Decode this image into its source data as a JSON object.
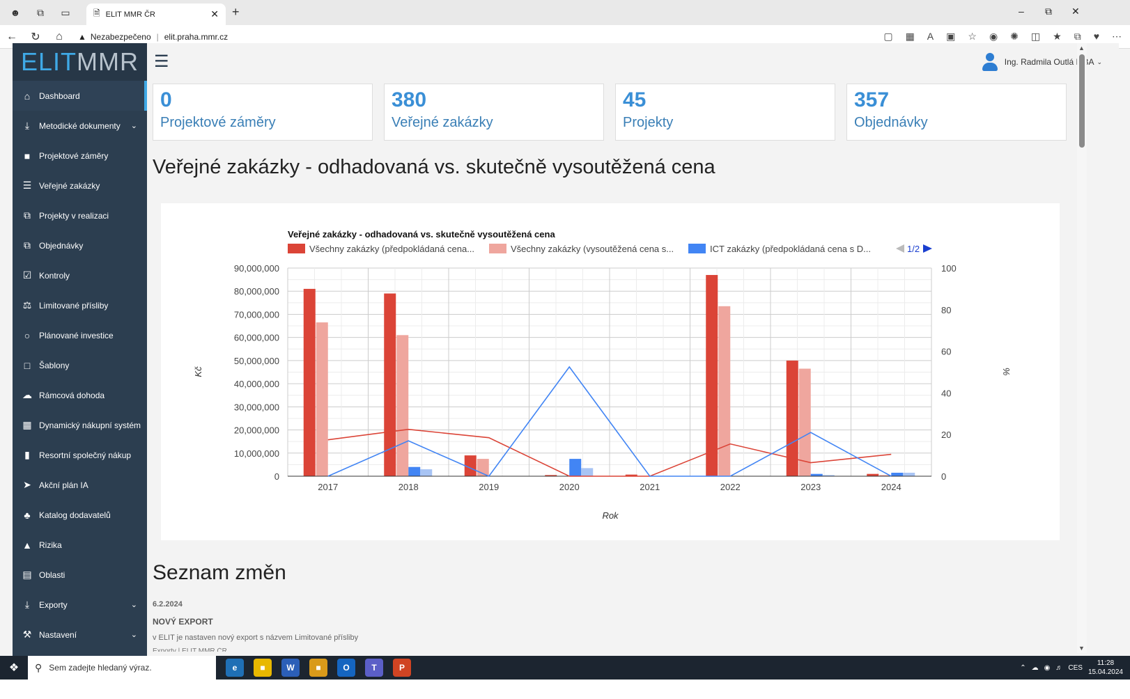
{
  "browser": {
    "tab_title": "ELIT MMR ČR",
    "address_warning": "Nezabezpečeno",
    "url": "elit.praha.mmr.cz"
  },
  "app": {
    "logo_part1": "ELIT",
    "logo_part2": "MMR",
    "user_name": "Ing. Radmila Outlá MBA"
  },
  "sidebar": {
    "items": [
      {
        "label": "Dashboard",
        "icon": "home-icon"
      },
      {
        "label": "Metodické dokumenty",
        "icon": "download-icon",
        "has_children": true
      },
      {
        "label": "Projektové záměry",
        "icon": "folder-icon"
      },
      {
        "label": "Veřejné zakázky",
        "icon": "list-icon"
      },
      {
        "label": "Projekty v realizaci",
        "icon": "copy-icon"
      },
      {
        "label": "Objednávky",
        "icon": "copy-icon"
      },
      {
        "label": "Kontroly",
        "icon": "check-square-icon"
      },
      {
        "label": "Limitované přísliby",
        "icon": "balance-icon"
      },
      {
        "label": "Plánované investice",
        "icon": "tag-icon"
      },
      {
        "label": "Šablony",
        "icon": "file-icon"
      },
      {
        "label": "Rámcová dohoda",
        "icon": "cloud-icon"
      },
      {
        "label": "Dynamický nákupní systém",
        "icon": "grid-icon"
      },
      {
        "label": "Resortní společný nákup",
        "icon": "building-icon"
      },
      {
        "label": "Akční plán IA",
        "icon": "paper-plane-icon"
      },
      {
        "label": "Katalog dodavatelů",
        "icon": "tree-icon"
      },
      {
        "label": "Rizika",
        "icon": "lock-icon"
      },
      {
        "label": "Oblasti",
        "icon": "table-icon"
      },
      {
        "label": "Exporty",
        "icon": "download-icon",
        "has_children": true
      },
      {
        "label": "Nastavení",
        "icon": "wrench-icon",
        "has_children": true
      }
    ]
  },
  "stats": [
    {
      "value": "0",
      "label": "Projektové záměry"
    },
    {
      "value": "380",
      "label": "Veřejné zakázky"
    },
    {
      "value": "45",
      "label": "Projekty"
    },
    {
      "value": "357",
      "label": "Objednávky"
    }
  ],
  "main": {
    "section_title": "Veřejné zakázky - odhadovaná vs. skutečně vysoutěžená cena",
    "changelog_title": "Seznam změn",
    "changelog_date": "6.2.2024",
    "changelog_entry_title": "NOVÝ EXPORT",
    "changelog_entry_text": "v ELIT je nastaven nový export s názvem Limitované přísliby",
    "changelog_next": "Exporty | ELIT MMR ČR"
  },
  "chart_data": {
    "type": "bar",
    "title": "Veřejné zakázky - odhadovaná vs. skutečně vysoutěžená cena",
    "xlabel": "Rok",
    "ylabel": "Kč",
    "y2label": "%",
    "categories": [
      "2017",
      "2018",
      "2019",
      "2020",
      "2021",
      "2022",
      "2023",
      "2024"
    ],
    "ylim": [
      0,
      90000000
    ],
    "y2lim": [
      0,
      100
    ],
    "yticks": [
      "0",
      "10,000,000",
      "20,000,000",
      "30,000,000",
      "40,000,000",
      "50,000,000",
      "60,000,000",
      "70,000,000",
      "80,000,000",
      "90,000,000"
    ],
    "y2ticks": [
      "0",
      "20",
      "40",
      "60",
      "80",
      "100"
    ],
    "legend_page": "1/2",
    "legend": [
      {
        "name": "Všechny zakázky (předpokládaná cena...",
        "color": "#db4437"
      },
      {
        "name": "Všechny zakázky (vysoutěžená cena s...",
        "color": "#efa69e"
      },
      {
        "name": "ICT zakázky (předpokládaná cena s D...",
        "color": "#4285f4"
      }
    ],
    "bar_series": [
      {
        "color": "#db4437",
        "values": [
          81000000,
          79000000,
          9000000,
          500000,
          700000,
          87000000,
          50000000,
          1000000
        ]
      },
      {
        "color": "#efa69e",
        "values": [
          66500000,
          61000000,
          7500000,
          0,
          0,
          73500000,
          46500000,
          500000
        ]
      },
      {
        "color": "#4285f4",
        "values": [
          0,
          4000000,
          0,
          7500000,
          0,
          0,
          1000000,
          1500000
        ]
      },
      {
        "color": "#a8c4f4",
        "values": [
          0,
          3000000,
          0,
          3500000,
          0,
          0,
          500000,
          1500000
        ]
      }
    ],
    "line_series": [
      {
        "color": "#db4437",
        "axis": "right",
        "values": [
          17.5,
          22.5,
          18.5,
          0,
          0,
          15.5,
          6.5,
          10.5
        ]
      },
      {
        "color": "#4285f4",
        "axis": "right",
        "values": [
          0,
          17,
          0,
          52.5,
          0,
          0,
          21,
          0
        ]
      }
    ],
    "grid": true,
    "legend_position": "top"
  },
  "taskbar": {
    "search_placeholder": "Sem zadejte hledaný výraz.",
    "language": "CES",
    "time": "11:28",
    "date": "15.04.2024"
  }
}
